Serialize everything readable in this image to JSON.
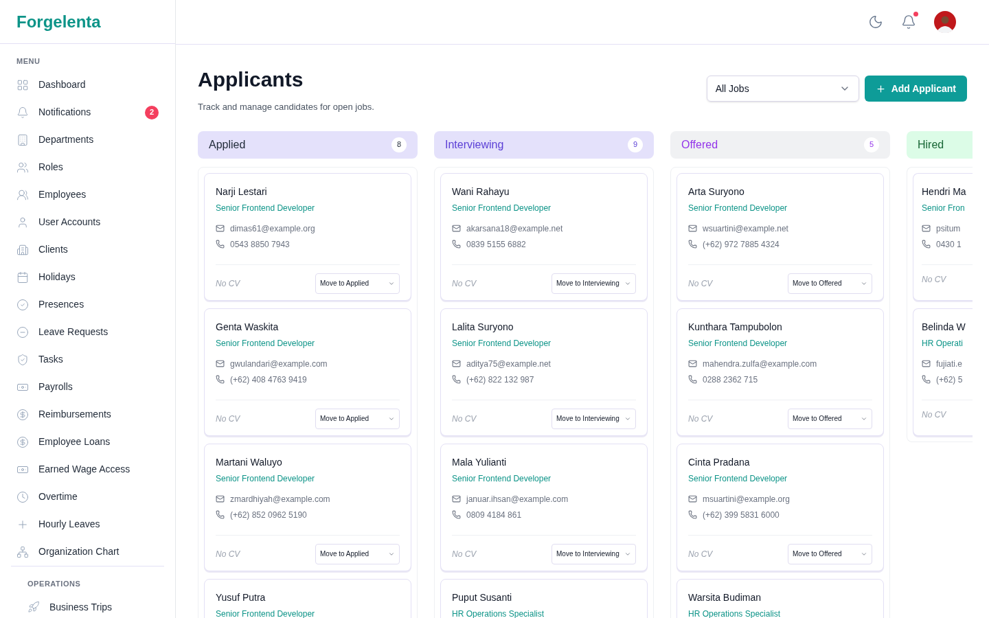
{
  "brand": "Forgelenta",
  "sidebar": {
    "sections": [
      {
        "title": "MENU",
        "items": [
          {
            "label": "Dashboard"
          },
          {
            "label": "Notifications",
            "badge": "2"
          },
          {
            "label": "Departments"
          },
          {
            "label": "Roles"
          },
          {
            "label": "Employees"
          },
          {
            "label": "User Accounts"
          },
          {
            "label": "Clients"
          },
          {
            "label": "Holidays"
          },
          {
            "label": "Presences"
          },
          {
            "label": "Leave Requests"
          },
          {
            "label": "Tasks"
          },
          {
            "label": "Payrolls"
          },
          {
            "label": "Reimbursements"
          },
          {
            "label": "Employee Loans"
          },
          {
            "label": "Earned Wage Access"
          },
          {
            "label": "Overtime"
          },
          {
            "label": "Hourly Leaves"
          },
          {
            "label": "Organization Chart"
          }
        ]
      },
      {
        "title": "OPERATIONS",
        "items": [
          {
            "label": "Business Trips"
          }
        ]
      }
    ]
  },
  "page": {
    "title": "Applicants",
    "subtitle": "Track and manage candidates for open jobs.",
    "filter": {
      "value": "All Jobs"
    },
    "add_button": "Add Applicant"
  },
  "columns": [
    {
      "title": "Applied",
      "count": "8",
      "color": "#e4e1fb",
      "cards": [
        {
          "name": "Narji Lestari",
          "role": "Senior Frontend Developer",
          "email": "dimas61@example.org",
          "phone": "0543 8850 7943",
          "cv": "No CV",
          "action": "Move to Applied"
        },
        {
          "name": "Genta Waskita",
          "role": "Senior Frontend Developer",
          "email": "gwulandari@example.com",
          "phone": "(+62) 408 4763 9419",
          "cv": "No CV",
          "action": "Move to Applied"
        },
        {
          "name": "Martani Waluyo",
          "role": "Senior Frontend Developer",
          "email": "zmardhiyah@example.com",
          "phone": "(+62) 852 0962 5190",
          "cv": "No CV",
          "action": "Move to Applied"
        },
        {
          "name": "Yusuf Putra",
          "role": "Senior Frontend Developer"
        }
      ]
    },
    {
      "title": "Interviewing",
      "count": "9",
      "color": "#e4e1fb",
      "cards": [
        {
          "name": "Wani Rahayu",
          "role": "Senior Frontend Developer",
          "email": "akarsana18@example.net",
          "phone": "0839 5155 6882",
          "cv": "No CV",
          "action": "Move to Interviewing"
        },
        {
          "name": "Lalita Suryono",
          "role": "Senior Frontend Developer",
          "email": "aditya75@example.net",
          "phone": "(+62) 822 132 987",
          "cv": "No CV",
          "action": "Move to Interviewing"
        },
        {
          "name": "Mala Yulianti",
          "role": "Senior Frontend Developer",
          "email": "januar.ihsan@example.com",
          "phone": "0809 4184 861",
          "cv": "No CV",
          "action": "Move to Interviewing"
        },
        {
          "name": "Puput Susanti",
          "role": "HR Operations Specialist"
        }
      ]
    },
    {
      "title": "Offered",
      "count": "5",
      "color": "#f0f1f3",
      "cards": [
        {
          "name": "Arta Suryono",
          "role": "Senior Frontend Developer",
          "email": "wsuartini@example.net",
          "phone": "(+62) 972 7885 4324",
          "cv": "No CV",
          "action": "Move to Offered"
        },
        {
          "name": "Kunthara Tampubolon",
          "role": "Senior Frontend Developer",
          "email": "mahendra.zulfa@example.com",
          "phone": "0288 2362 715",
          "cv": "No CV",
          "action": "Move to Offered"
        },
        {
          "name": "Cinta Pradana",
          "role": "Senior Frontend Developer",
          "email": "msuartini@example.org",
          "phone": "(+62) 399 5831 6000",
          "cv": "No CV",
          "action": "Move to Offered"
        },
        {
          "name": "Warsita Budiman",
          "role": "HR Operations Specialist"
        }
      ]
    },
    {
      "title": "Hired",
      "color": "#dcfce7",
      "cards": [
        {
          "name": "Hendri Ma",
          "role": "Senior Fron",
          "email": "psitum",
          "phone": "0430 1",
          "cv": "No CV"
        },
        {
          "name": "Belinda W",
          "role": "HR Operati",
          "email": "fujiati.e",
          "phone": "(+62) 5",
          "cv": "No CV"
        }
      ]
    }
  ]
}
